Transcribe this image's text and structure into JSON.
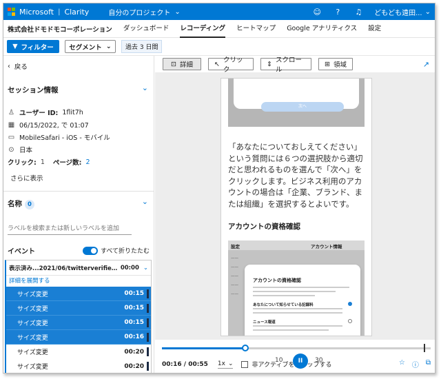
{
  "topbar": {
    "brand": "Microsoft",
    "product": "Clarity",
    "project": "自分のプロジェクト",
    "user": "どもども遠田...",
    "help": "?",
    "colors": {
      "bar": "#0078d4",
      "logo": [
        "#f25022",
        "#7fba00",
        "#00a4ef",
        "#ffb900"
      ]
    }
  },
  "nav": {
    "company": "株式会社ドモドモコーポレーション",
    "items": [
      "ダッシュボード",
      "レコーディング",
      "ヒートマップ",
      "Google アナリティクス",
      "設定"
    ],
    "active": "レコーディング"
  },
  "filters": {
    "filter_label": "フィルター",
    "segment_label": "セグメント",
    "date_tag": "過去 3 日間"
  },
  "left": {
    "back": "戻る",
    "session_title": "セッション情報",
    "user_id_label": "ユーザー ID:",
    "user_id": "1flit7h",
    "datetime": "06/15/2022, で 01:07",
    "device": "MobileSafari - iOS - モバイル",
    "country": "日本",
    "clicks_label": "クリック:",
    "clicks": "1",
    "pages_label": "ページ数:",
    "pages": "2",
    "show_more": "さらに表示",
    "labels_title": "名称",
    "labels_count": "0",
    "label_placeholder": "ラベルを検索または新しいラベルを追加",
    "events_title": "イベント",
    "collapse_all": "すべて折りたたむ",
    "pageview": {
      "url": "表示済み...2021/06/twitterverifiedaccou...",
      "time": "00:00"
    },
    "expand_details": "詳細を展開する",
    "events": [
      {
        "name": "サイズ変更",
        "time": "00:15",
        "selected": true
      },
      {
        "name": "サイズ変更",
        "time": "00:15",
        "selected": true
      },
      {
        "name": "サイズ変更",
        "time": "00:15",
        "selected": true
      },
      {
        "name": "サイズ変更",
        "time": "00:16",
        "selected": true
      },
      {
        "name": "サイズ変更",
        "time": "00:20",
        "selected": false
      },
      {
        "name": "サイズ変更",
        "time": "00:20",
        "selected": false
      }
    ]
  },
  "toolbar": {
    "details": "詳細",
    "click": "クリック",
    "scroll": "スクロール",
    "area": "領域"
  },
  "content": {
    "shot_button": "次へ",
    "paragraph": "「あなたについておしえてください」という質問には６つの選択肢から適切だと思われるものを選んで「次へ」をクリックします。ビジネス利用のアカウントの場合は「企業、ブランド、または組織」を選択するとよいです。",
    "heading": "アカウントの資格確認",
    "shot2_header_left": "設定",
    "shot2_header_right": "アカウント情報",
    "shot2_card_title": "アカウントの資格確認",
    "shot2_sub1": "あなたについて知らせている記録料",
    "shot2_sub2": "ニュース報道"
  },
  "player": {
    "current": "00:16",
    "total": "00:55",
    "speed": "1x",
    "skip_inactive": "非アクティブをスキップする",
    "progress": 0.31,
    "play_label": "II",
    "back_skip": "10",
    "fwd_skip": "30"
  }
}
